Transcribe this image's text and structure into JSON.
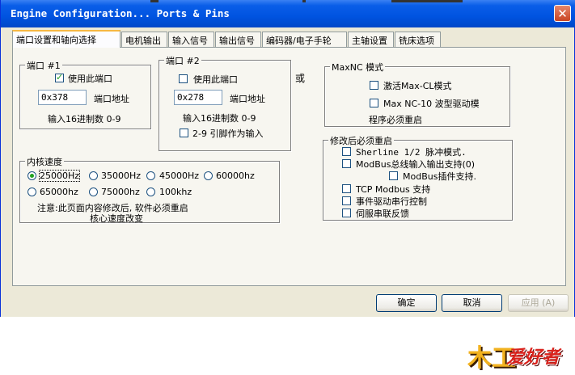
{
  "window": {
    "title": "Engine Configuration... Ports & Pins",
    "close_label": "✕"
  },
  "tabs": [
    "端口设置和轴向选择",
    "电机输出",
    "输入信号",
    "输出信号",
    "编码器/电子手轮",
    "主轴设置",
    "铣床选项"
  ],
  "port1": {
    "title": "端口 #1",
    "enable_label": "使用此端口",
    "enable_checked": true,
    "address_value": "0x378",
    "address_label": "端口地址",
    "hint": "输入16进制数 0-9"
  },
  "port2": {
    "title": "端口 #2",
    "enable_label": "使用此端口",
    "enable_checked": false,
    "address_value": "0x278",
    "address_label": "端口地址",
    "hint": "输入16进制数 0-9",
    "pins_label": "2-9 引脚作为输入"
  },
  "or_label": "或",
  "maxnc": {
    "title": "MaxNC 模式",
    "opt1_label": "激活Max-CL模式",
    "opt2_label": "Max NC-10 波型驱动模",
    "note": "程序必须重启"
  },
  "restart": {
    "title": "修改后必须重启",
    "options": [
      "Sherline 1/2 脉冲模式.",
      "ModBus总线输入输出支持(0)",
      "ModBus插件支持.",
      "TCP Modbus 支持",
      "事件驱动串行控制",
      "伺服串联反馈"
    ]
  },
  "kernel": {
    "title": "内核速度",
    "speeds": [
      "25000Hz",
      "35000Hz",
      "45000Hz",
      "60000hz",
      "65000hz",
      "75000hz",
      "100khz"
    ],
    "selected": "25000Hz",
    "note_line1": "注意:此页面内容修改后, 软件必须重启",
    "note_line2": "核心速度改变"
  },
  "buttons": {
    "ok": "确定",
    "cancel": "取消",
    "apply": "应用 (A)"
  },
  "watermark": {
    "part1": "木工",
    "part2": "爱好者"
  }
}
